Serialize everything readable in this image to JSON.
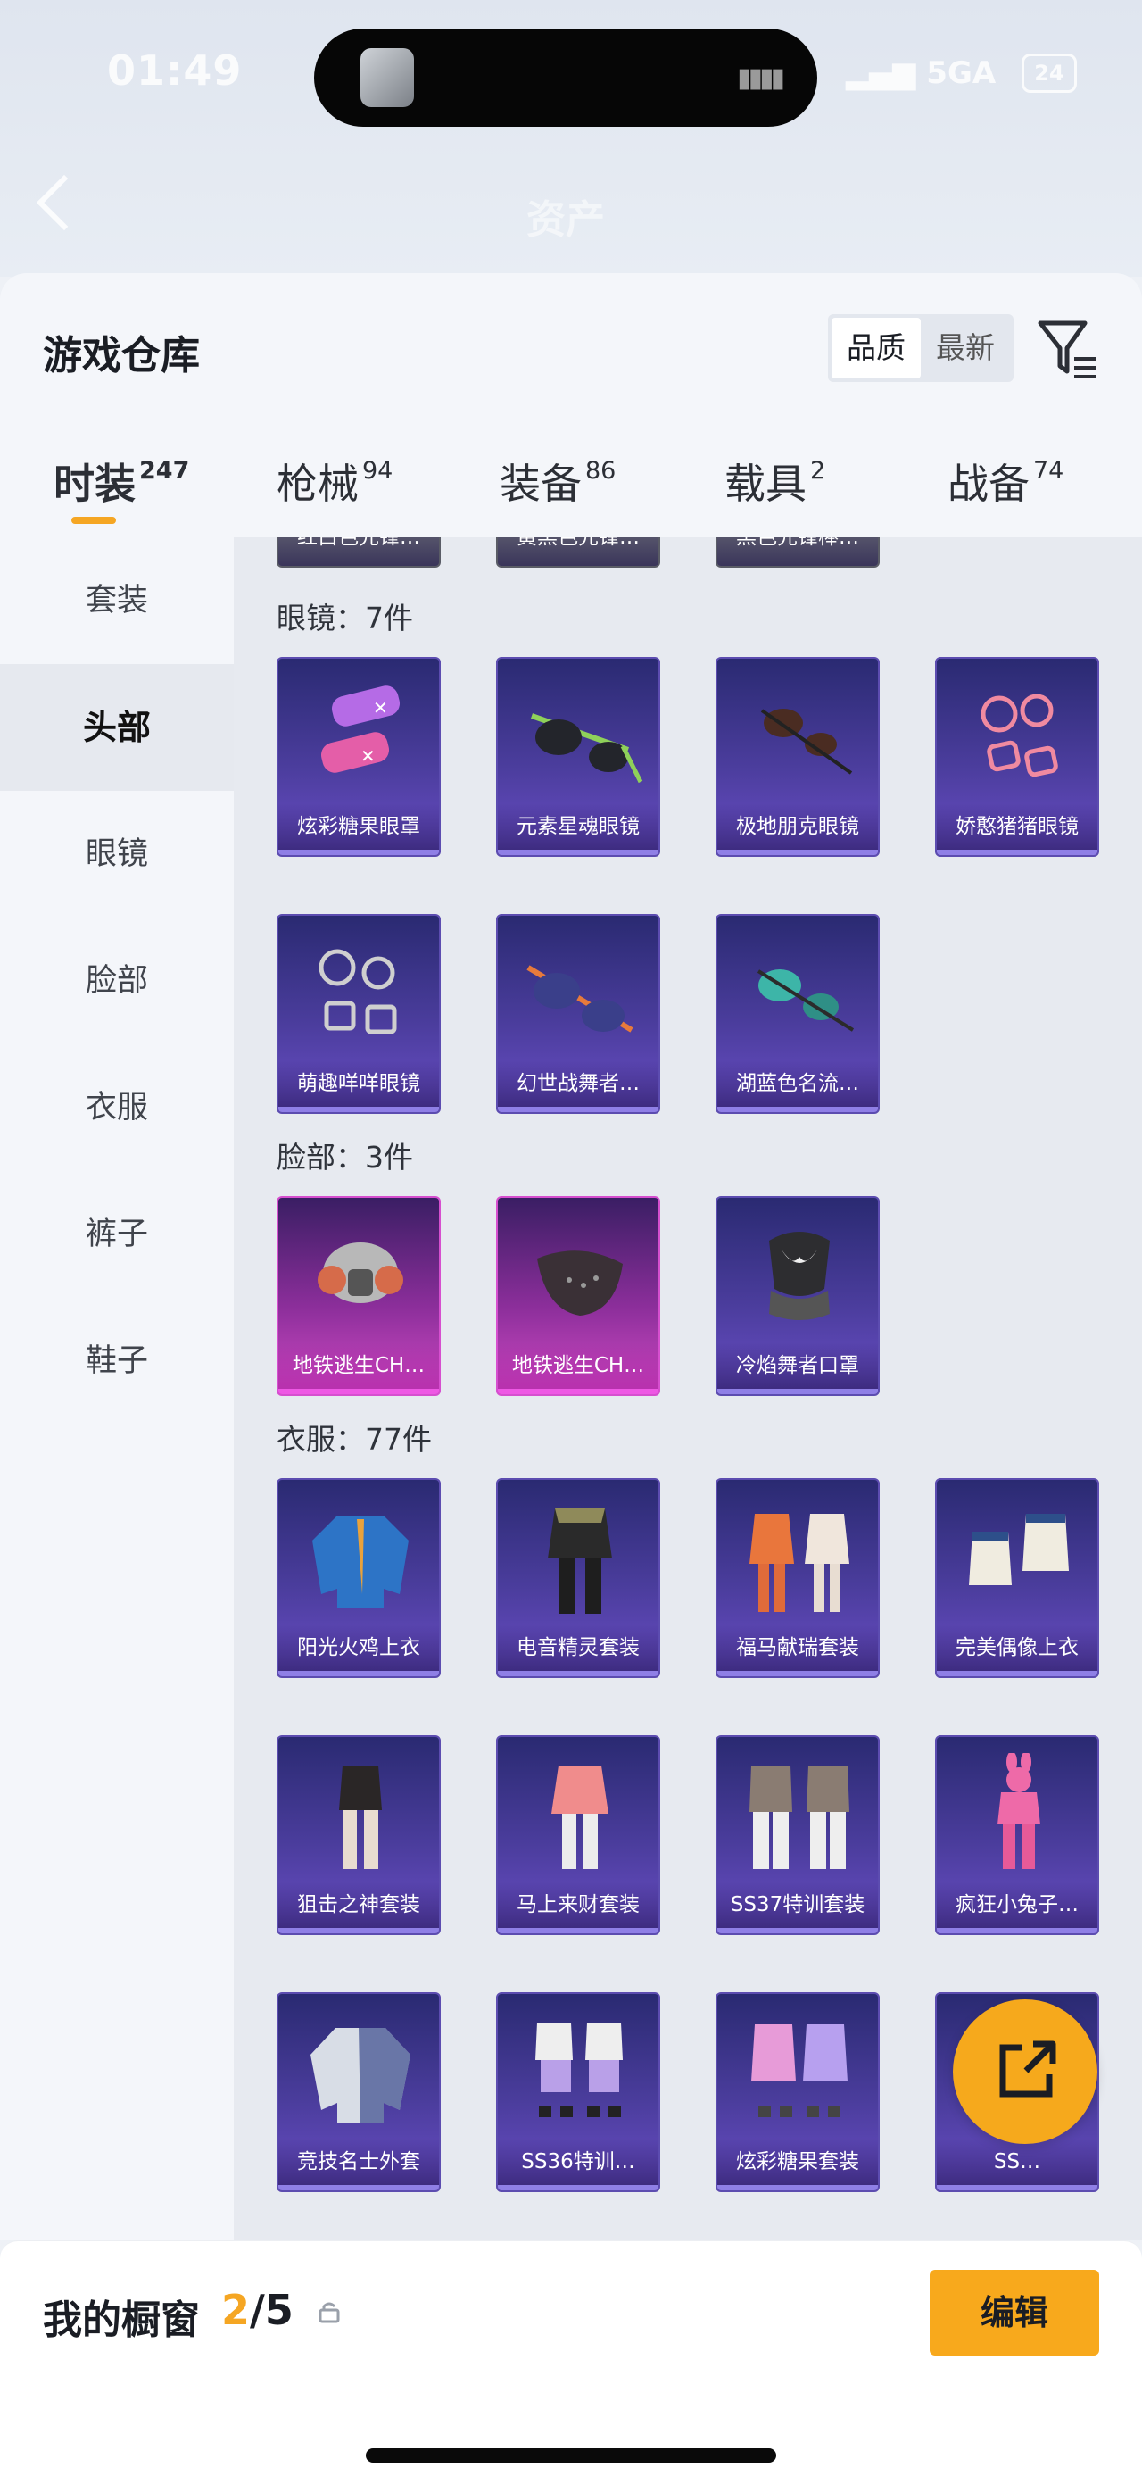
{
  "status": {
    "time": "01:49",
    "network": "5GA",
    "battery": "24"
  },
  "header": {
    "title": "资产"
  },
  "warehouse": {
    "title": "游戏仓库",
    "sort": {
      "quality": "品质",
      "newest": "最新"
    },
    "tabs": [
      {
        "label": "时装",
        "count": "247"
      },
      {
        "label": "枪械",
        "count": "94"
      },
      {
        "label": "装备",
        "count": "86"
      },
      {
        "label": "载具",
        "count": "2"
      },
      {
        "label": "战备",
        "count": "74"
      }
    ],
    "sidebar": [
      "套装",
      "头部",
      "眼镜",
      "脸部",
      "衣服",
      "裤子",
      "鞋子"
    ],
    "top_partial": [
      "红白色先锋…",
      "黄黑色先锋…",
      "黑色先锋棒…"
    ],
    "sections": {
      "glasses": {
        "title": "眼镜：7件",
        "items": [
          "炫彩糖果眼罩",
          "元素星魂眼镜",
          "极地朋克眼镜",
          "娇憨猪猪眼镜",
          "萌趣咩咩眼镜",
          "幻世战舞者…",
          "湖蓝色名流…"
        ]
      },
      "face": {
        "title": "脸部：3件",
        "items": [
          "地铁逃生CH…",
          "地铁逃生CH…",
          "冷焰舞者口罩"
        ]
      },
      "clothes": {
        "title": "衣服：77件",
        "items": [
          "阳光火鸡上衣",
          "电音精灵套装",
          "福马献瑞套装",
          "完美偶像上衣",
          "狙击之神套装",
          "马上来财套装",
          "SS37特训套装",
          "疯狂小兔子…",
          "竞技名士外套",
          "SS36特训…",
          "炫彩糖果套装",
          "SS…"
        ]
      }
    }
  },
  "footer": {
    "title": "我的橱窗",
    "count_current": "2",
    "count_total": "/5",
    "edit": "编辑"
  },
  "colors": {
    "accent": "#f5a623",
    "card_epic": "#4b3d9d",
    "card_legend": "#d04bc4"
  }
}
